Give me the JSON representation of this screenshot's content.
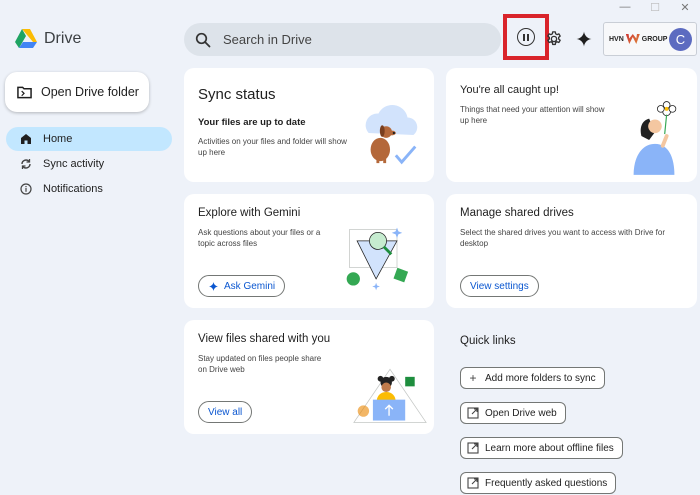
{
  "window": {
    "minimize": "—",
    "maximize": "☐",
    "close": "✕"
  },
  "app": {
    "name": "Drive"
  },
  "search": {
    "placeholder": "Search in Drive"
  },
  "account": {
    "brand": "HVN",
    "brand2": "GROUP",
    "avatar_letter": "C"
  },
  "sidebar": {
    "open_folder_label": "Open Drive folder",
    "items": [
      {
        "label": "Home",
        "icon": "home-icon",
        "active": true
      },
      {
        "label": "Sync activity",
        "icon": "sync-icon",
        "active": false
      },
      {
        "label": "Notifications",
        "icon": "info-icon",
        "active": false
      }
    ]
  },
  "cards": {
    "sync": {
      "title": "Sync status",
      "subtitle": "Your files are up to date",
      "text": "Activities on your files and folder will show up here"
    },
    "caught_up": {
      "title": "You're all caught up!",
      "text": "Things that need your attention will show up here"
    },
    "gemini": {
      "title": "Explore with Gemini",
      "text": "Ask questions about your files or a topic across files",
      "button": "Ask Gemini"
    },
    "shared_drives": {
      "title": "Manage shared drives",
      "text": "Select the shared drives you want to access with Drive for desktop",
      "button": "View settings"
    },
    "shared_files": {
      "title": "View files shared with you",
      "text": "Stay updated on files people share on Drive web",
      "button": "View all"
    }
  },
  "quick_links": {
    "title": "Quick links",
    "items": [
      {
        "label": "Add more folders to sync",
        "icon": "plus-icon"
      },
      {
        "label": "Open Drive web",
        "icon": "external-link-icon"
      },
      {
        "label": "Learn more about offline files",
        "icon": "external-link-icon"
      },
      {
        "label": "Frequently asked questions",
        "icon": "external-link-icon"
      }
    ]
  },
  "colors": {
    "accent": "#0b57d0",
    "active_nav": "#c2e7ff",
    "highlight_box": "#d9242b",
    "background": "#eef2f9"
  }
}
